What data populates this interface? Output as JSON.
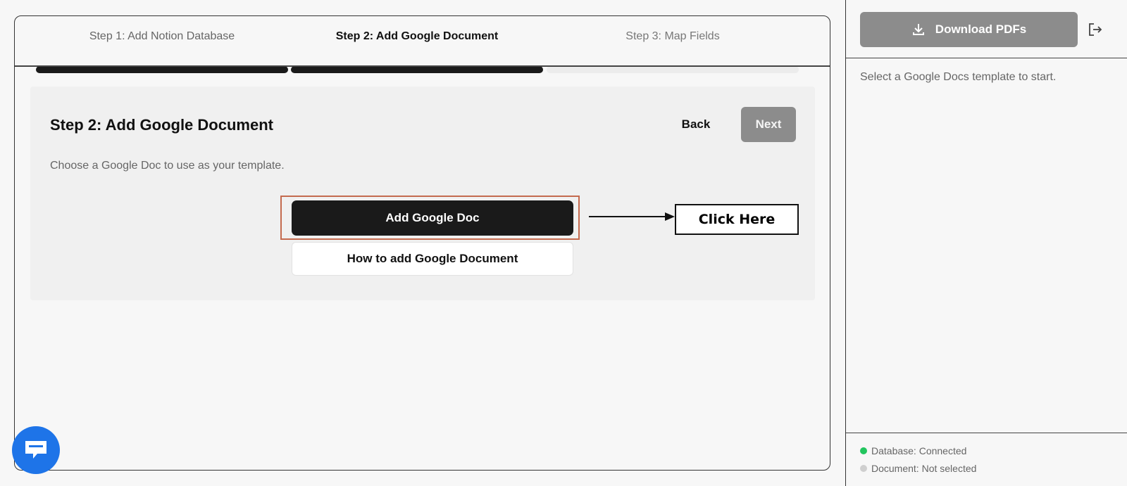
{
  "steps": [
    {
      "label": "Step 1: Add Notion Database",
      "state": "done"
    },
    {
      "label": "Step 2: Add Google Document",
      "state": "active"
    },
    {
      "label": "Step 3: Map Fields",
      "state": "todo"
    }
  ],
  "panel": {
    "title": "Step 2: Add Google Document",
    "description": "Choose a Google Doc to use as your template.",
    "back_label": "Back",
    "next_label": "Next",
    "add_doc_label": "Add Google Doc",
    "howto_label": "How to add Google Document",
    "annotation_label": "Click Here"
  },
  "sidebar": {
    "download_label": "Download PDFs",
    "hint": "Select a Google Docs template to start.",
    "status": [
      {
        "text": "Database: Connected",
        "color": "#22c55e"
      },
      {
        "text": "Document: Not selected",
        "color": "#cfcfcf"
      }
    ]
  },
  "colors": {
    "accent_dark": "#1a1a1a",
    "disabled_gray": "#8c8c8c",
    "annotation_highlight": "#c46a4e",
    "chat_blue": "#1e74e8"
  },
  "icons": {
    "download": "download-icon",
    "logout": "logout-icon",
    "chat": "chat-icon",
    "arrow": "arrow-right-icon"
  }
}
